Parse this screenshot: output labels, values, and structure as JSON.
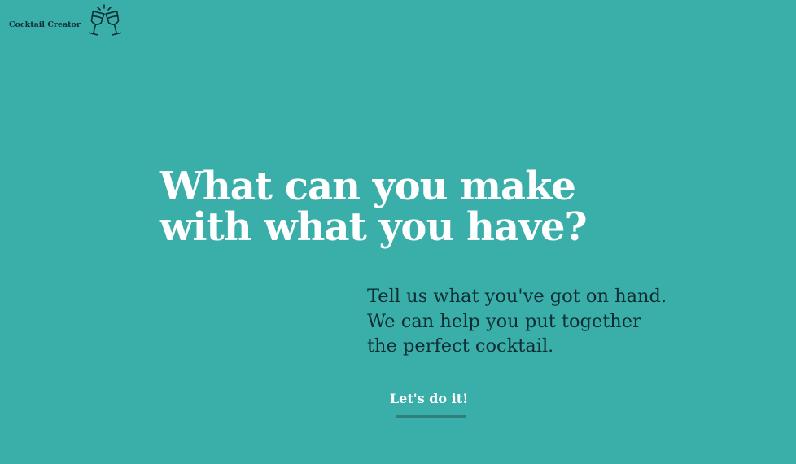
{
  "brand": {
    "name": "Cocktail Creator",
    "icon": "clinking-glasses-icon"
  },
  "hero": {
    "headline_line1": "What can you make",
    "headline_line2": "with what you have?",
    "tagline_line1": "Tell us what you've got on hand.",
    "tagline_line2": "We can help you put together",
    "tagline_line3": "the perfect cocktail.",
    "cta_label": "Let's do it!"
  },
  "colors": {
    "background": "#3aafa9",
    "headline": "#ffffff",
    "body_text": "#0f2d33",
    "cta_underline": "#2f7f7c"
  }
}
